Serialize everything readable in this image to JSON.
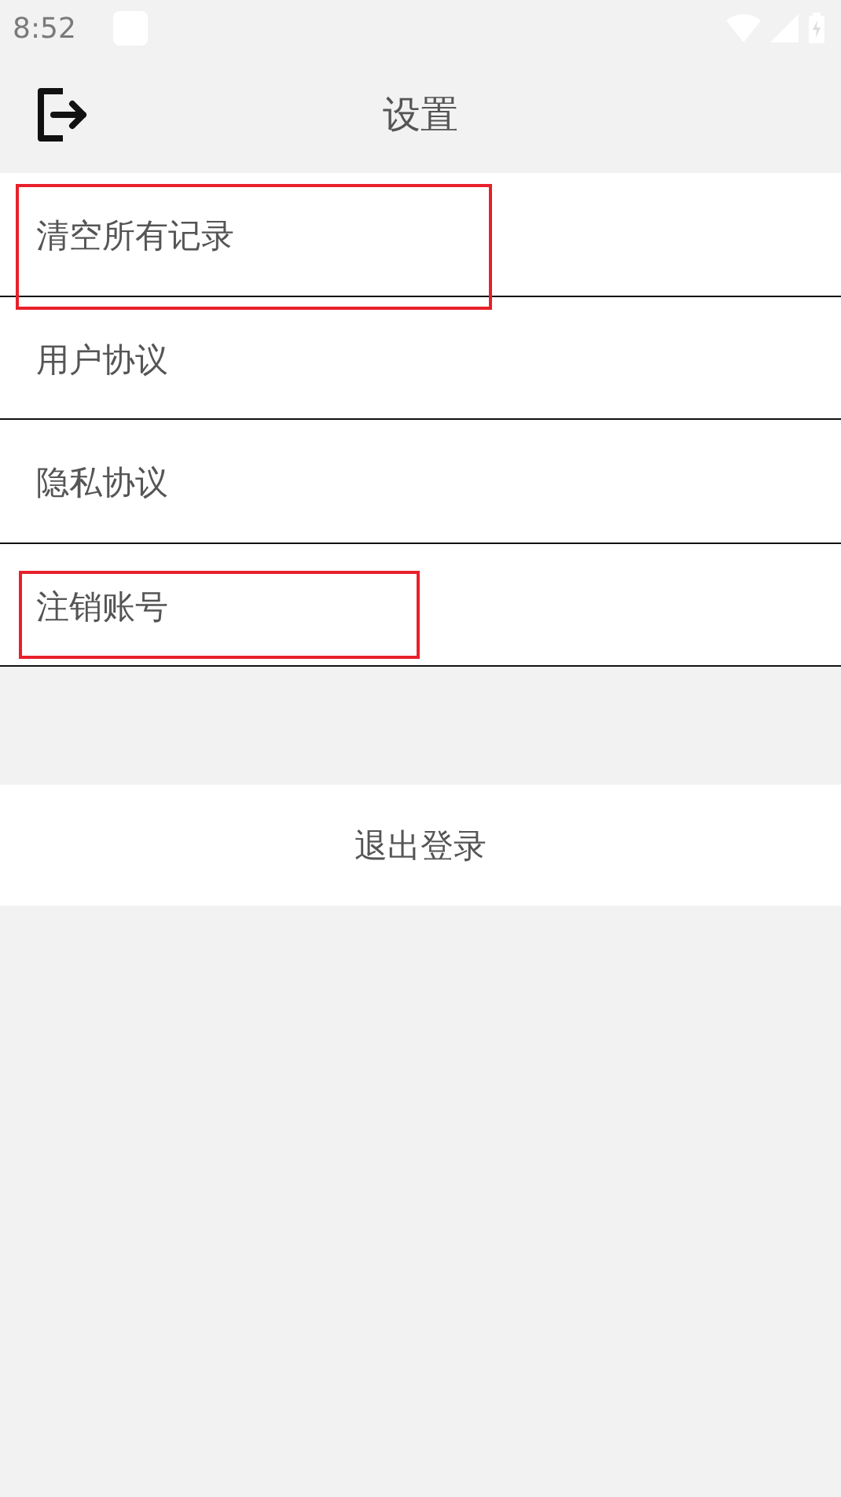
{
  "status_bar": {
    "time": "8:52"
  },
  "header": {
    "title": "设置"
  },
  "items": [
    {
      "label": "清空所有记录",
      "highlighted": true
    },
    {
      "label": "用户协议",
      "highlighted": false
    },
    {
      "label": "隐私协议",
      "highlighted": false
    },
    {
      "label": "注销账号",
      "highlighted": true
    }
  ],
  "logout_button": {
    "label": "退出登录"
  }
}
